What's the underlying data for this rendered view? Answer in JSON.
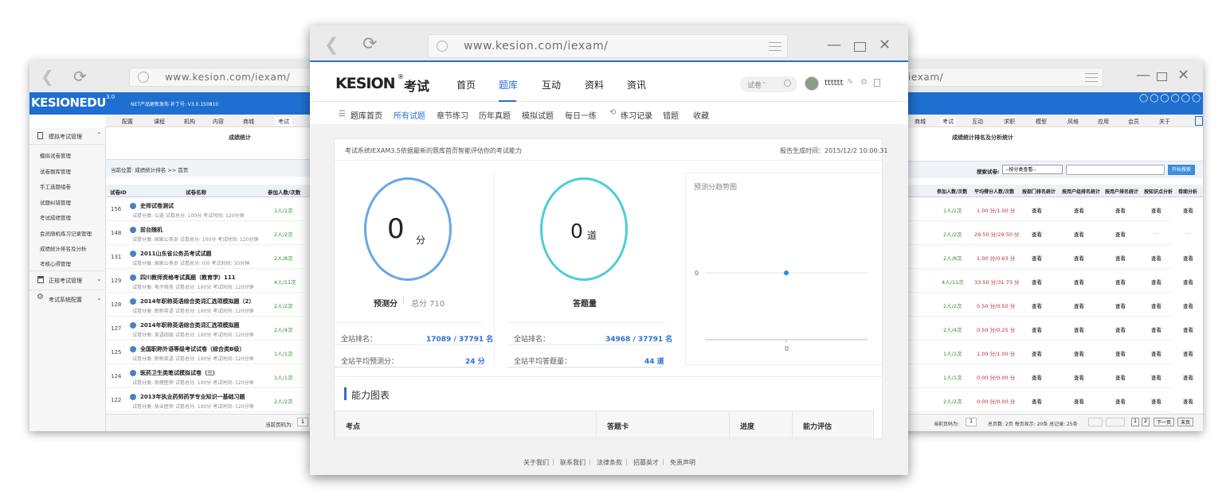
{
  "browser": {
    "url": "www.kesion.com/iexam/"
  },
  "left": {
    "logo": "KESIONEDU",
    "logo_version": "3.0",
    "notice": "NET产品更新发布 补丁号: V3.0.150810",
    "tabs": [
      "配置",
      "课程",
      "机构",
      "内容",
      "商城",
      "考试"
    ],
    "page_title": "成绩统计",
    "breadcrumb": "当前位置: 成绩统计排名 >> 首页",
    "sidebar": {
      "group1": "模拟考试管理",
      "items": [
        "模拟试卷管理",
        "试卷题库管理",
        "手工选题组卷",
        "试题纠错管理",
        "考试成绩管理",
        "会员随机练习记录管理",
        "成绩统计排名及分析",
        "考核心得管理"
      ],
      "group2": "正规考试管理",
      "group3": "考试系统配置"
    },
    "table_headers": [
      "试卷ID",
      "试卷名称",
      "参加人数/次数"
    ],
    "rows": [
      {
        "id": "156",
        "name": "史师试卷测试",
        "info": "试卷分类: 公选 试卷总分: 100分 考试时间: 120分钟",
        "count": "1人/1次"
      },
      {
        "id": "148",
        "name": "前台随机",
        "info": "试卷分类: 国家公务员 试卷总分: 100分 考试时间: 120分钟",
        "count": "2人/2次"
      },
      {
        "id": "131",
        "name": "2011山东省公务员考试试题",
        "info": "试卷分类: 国家公务员 试卷总分: 0分 考试时间: 30分钟",
        "count": "2人/8次"
      },
      {
        "id": "129",
        "name": "四川教师资格考试真题（教育学）111",
        "info": "试卷分类: 电子商务 试卷总分: 100分 考试时间: 120分钟",
        "count": "4人/11次"
      },
      {
        "id": "128",
        "name": "2014年职称英语综合类词汇选项模拟题（2）",
        "info": "试卷分类: 职称英语 试卷总分: 100分 考试时间: 120分钟",
        "count": "2人/2次"
      },
      {
        "id": "127",
        "name": "2014年职称英语综合类词汇选项模拟题",
        "info": "试卷分类: 英语四级 试卷总分: 100分 考试时间: 120分钟",
        "count": "2人/4次"
      },
      {
        "id": "125",
        "name": "全国职称外语等级考试试卷（综合类B级）",
        "info": "试卷分类: 职称英语 试卷总分: 100分 考试时间: 120分钟",
        "count": "1人/1次"
      },
      {
        "id": "124",
        "name": "医药卫生类笔试模拟试卷（三）",
        "info": "试卷分类: 助理医师 试卷总分: 100分 考试时间: 120分钟",
        "count": "1人/1次"
      },
      {
        "id": "122",
        "name": "2013年执业药师药学专业知识一基础习题",
        "info": "试卷分类: 执业医师 试卷总分: 100分 考试时间: 120分钟",
        "count": "2人/2次"
      }
    ],
    "page_label": "当前页码为:",
    "page_value": "1"
  },
  "right": {
    "tabs": [
      "商城",
      "考试",
      "互动",
      "求职",
      "模型",
      "风格",
      "应用",
      "会员",
      "关于"
    ],
    "page_title": "成绩统计排名及分析统计",
    "filter_label": "搜索试卷:",
    "filter_select": "--按分类查看--",
    "search_button": "开始搜索",
    "table_headers": [
      "参加人数/次数",
      "平均得分人数/次数",
      "按部门排名统计",
      "按用户组排名统计",
      "按用户排名统计",
      "按知识点分析",
      "卷面分析"
    ],
    "rows": [
      {
        "count": "1人/1次",
        "avg": "1.00 分/1.00 分",
        "a": "查看",
        "b": "查看",
        "c": "查看",
        "d": "查看",
        "e": "查看"
      },
      {
        "count": "2人/2次",
        "avg": "29.50 分/29.50 分",
        "a": "查看",
        "b": "查看",
        "c": "查看",
        "d": "---",
        "e": "---"
      },
      {
        "count": "2人/8次",
        "avg": "1.00 分/0.63 分",
        "a": "查看",
        "b": "查看",
        "c": "查看",
        "d": "查看",
        "e": "查看"
      },
      {
        "count": "4人/11次",
        "avg": "33.50 分/31.73 分",
        "a": "查看",
        "b": "查看",
        "c": "查看",
        "d": "查看",
        "e": "查看"
      },
      {
        "count": "2人/2次",
        "avg": "0.50 分/0.50 分",
        "a": "查看",
        "b": "查看",
        "c": "查看",
        "d": "查看",
        "e": "查看"
      },
      {
        "count": "2人/4次",
        "avg": "0.50 分/0.25 分",
        "a": "查看",
        "b": "查看",
        "c": "查看",
        "d": "查看",
        "e": "查看"
      },
      {
        "count": "1人/1次",
        "avg": "1.00 分/1.00 分",
        "a": "查看",
        "b": "查看",
        "c": "查看",
        "d": "查看",
        "e": "查看"
      },
      {
        "count": "1人/1次",
        "avg": "0.00 分/0.00 分",
        "a": "查看",
        "b": "查看",
        "c": "查看",
        "d": "查看",
        "e": "查看"
      },
      {
        "count": "2人/2次",
        "avg": "0.00 分/0.00 分",
        "a": "查看",
        "b": "查看",
        "c": "查看",
        "d": "查看",
        "e": "查看"
      }
    ],
    "footer": {
      "page_label": "当前页码为:",
      "page_value": "1",
      "summary": "总页数: 2页 每页显示: 20条 总记录: 25条",
      "prev": "下一页",
      "last": "末页",
      "p1": "1",
      "p2": "2"
    }
  },
  "center": {
    "logo": "KESION",
    "logo_suffix": "考试",
    "nav": [
      "首页",
      "题库",
      "互动",
      "资料",
      "资讯"
    ],
    "active_nav": "题库",
    "search_select": "试卷",
    "username": "tttttt",
    "subnav": [
      "题库首页",
      "所有试题",
      "章节练习",
      "历年真题",
      "模拟试题",
      "每日一练",
      "练习记录",
      "错题",
      "收藏"
    ],
    "report_intro": "考试系统IEXAM3.5依据最新的题库首页智能评估你的考试能力",
    "report_time": "报告生成时间：2015/12/2 10:00:31",
    "score": {
      "value": "0",
      "unit": "分",
      "label": "预测分",
      "total_label": "总分 710"
    },
    "answered": {
      "value": "0",
      "unit": "道",
      "label": "答题量"
    },
    "stats_left": [
      {
        "label": "全站排名：",
        "value": "17089 / 37791 名"
      },
      {
        "label": "全站平均预测分：",
        "value": "24 分"
      }
    ],
    "stats_right": [
      {
        "label": "全站排名：",
        "value": "34968 / 37791 名"
      },
      {
        "label": "全站平均答题量：",
        "value": "44 道"
      }
    ],
    "trend": {
      "title": "预测分趋势图",
      "y_label": "0",
      "x_label": "0"
    },
    "ability_title": "能力图表",
    "ability_headers": [
      "考点",
      "答题卡",
      "进度",
      "能力评估"
    ],
    "footer_links": [
      "关于我们",
      "联系我们",
      "法律条款",
      "招募英才",
      "免责声明"
    ]
  },
  "chart_data": {
    "type": "line",
    "title": "预测分趋势图",
    "x": [
      0
    ],
    "series": [
      {
        "values": [
          0
        ]
      }
    ]
  },
  "colors": {
    "accent": "#2a6fd6",
    "ring_score": "#6aa7e6",
    "ring_answer": "#4fcdd6",
    "leftbar": "#1e6fcf"
  }
}
